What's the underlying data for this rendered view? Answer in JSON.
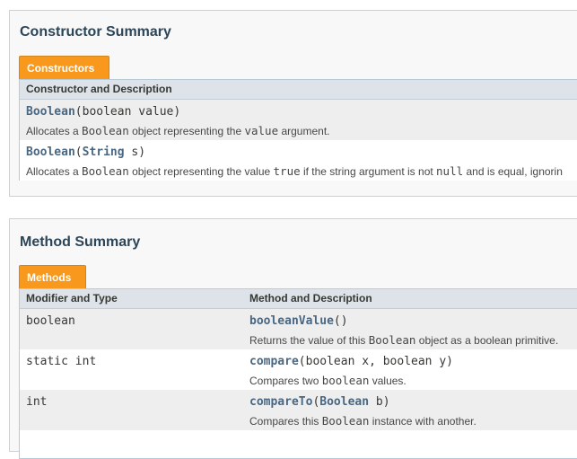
{
  "constructor_summary": {
    "title": "Constructor Summary",
    "tab_label": "Constructors",
    "header": "Constructor and Description",
    "rows": [
      {
        "name": "Boolean",
        "params_open": "(",
        "param_type_link": "",
        "params_text": "boolean value)",
        "desc_1": "Allocates a ",
        "desc_code_1": "Boolean",
        "desc_2": " object representing the ",
        "desc_code_2": "value",
        "desc_3": " argument.",
        "desc_code_3": "",
        "desc_4": "",
        "desc_code_4": "",
        "desc_5": ""
      },
      {
        "name": "Boolean",
        "params_open": "(",
        "param_type_link": "String",
        "params_text": " s)",
        "desc_1": "Allocates a ",
        "desc_code_1": "Boolean",
        "desc_2": " object representing the value ",
        "desc_code_2": "true",
        "desc_3": " if the string argument is not ",
        "desc_code_3": "null",
        "desc_4": " and is equal, ignorin",
        "desc_code_4": "",
        "desc_5": ""
      }
    ]
  },
  "method_summary": {
    "title": "Method Summary",
    "tab_label": "Methods",
    "header_col1": "Modifier and Type",
    "header_col2": "Method and Description",
    "rows": [
      {
        "type": "boolean",
        "name": "booleanValue",
        "params_open": "(",
        "param_type_link": "",
        "params_text": ")",
        "desc_1": "Returns the value of this ",
        "desc_code_1": "Boolean",
        "desc_2": " object as a boolean primitive."
      },
      {
        "type": "static int",
        "name": "compare",
        "params_open": "(",
        "param_type_link": "",
        "params_text": "boolean x, boolean y)",
        "desc_1": "Compares two ",
        "desc_code_1": "boolean",
        "desc_2": " values."
      },
      {
        "type": "int",
        "name": "compareTo",
        "params_open": "(",
        "param_type_link": "Boolean",
        "params_text": " b)",
        "desc_1": "Compares this ",
        "desc_code_1": "Boolean",
        "desc_2": " instance with another."
      }
    ]
  },
  "colors": {
    "tab_orange": "#f8981d",
    "link_blue": "#4a6782",
    "heading": "#2c4557",
    "table_header_bg": "#dee3e9",
    "row_alt_bg": "#eeeeef"
  }
}
